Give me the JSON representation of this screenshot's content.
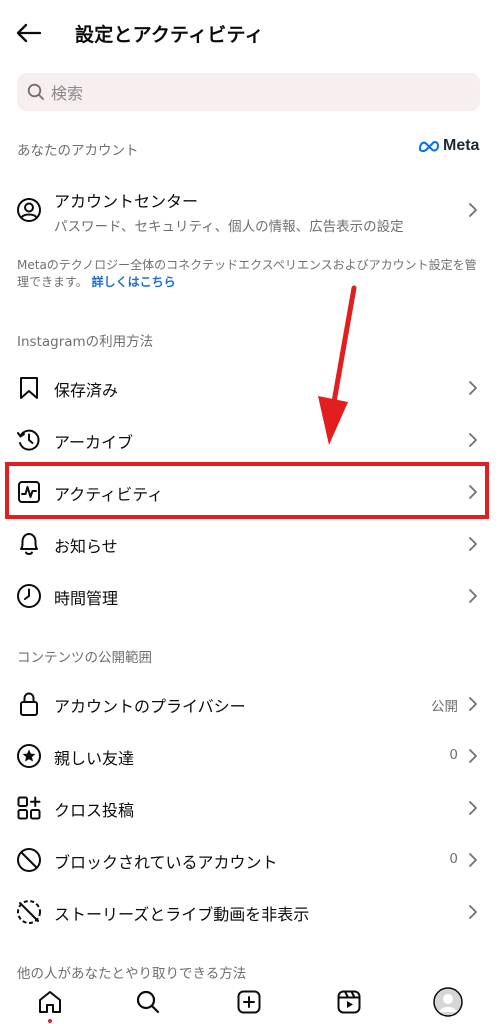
{
  "header": {
    "title": "設定とアクティビティ"
  },
  "search": {
    "placeholder": "検索"
  },
  "sections": {
    "your_account": "あなたのアカウント",
    "how_use": "Instagramの利用方法",
    "content_visibility": "コンテンツの公開範囲",
    "others_interaction": "他の人があなたとやり取りできる方法"
  },
  "meta_logo": {
    "text": "Meta"
  },
  "account_center": {
    "title": "アカウントセンター",
    "subtitle": "パスワード、セキュリティ、個人の情報、広告表示の設定"
  },
  "meta_note": {
    "text": "Metaのテクノロジー全体のコネクテッドエクスペリエンスおよびアカウント設定を管理できます。",
    "link": "詳しくはこちら"
  },
  "usage_items": [
    {
      "label": "保存済み",
      "icon": "bookmark-icon"
    },
    {
      "label": "アーカイブ",
      "icon": "archive-icon"
    },
    {
      "label": "アクティビティ",
      "icon": "activity-icon"
    },
    {
      "label": "お知らせ",
      "icon": "bell-icon"
    },
    {
      "label": "時間管理",
      "icon": "clock-icon"
    }
  ],
  "visibility_items": [
    {
      "label": "アカウントのプライバシー",
      "value": "公開",
      "icon": "lock-icon"
    },
    {
      "label": "親しい友達",
      "value": "0",
      "icon": "star-circle-icon"
    },
    {
      "label": "クロス投稿",
      "value": "",
      "icon": "grid-plus-icon"
    },
    {
      "label": "ブロックされているアカウント",
      "value": "0",
      "icon": "block-icon"
    },
    {
      "label": "ストーリーズとライブ動画を非表示",
      "value": "",
      "icon": "hide-story-icon"
    }
  ],
  "tabbar": [
    "home-icon",
    "search-icon",
    "new-post-icon",
    "reels-icon",
    "profile-avatar"
  ],
  "colors": {
    "highlight": "#e21e1e",
    "link": "#1b6fd8",
    "search_bg": "#f7eef0"
  }
}
